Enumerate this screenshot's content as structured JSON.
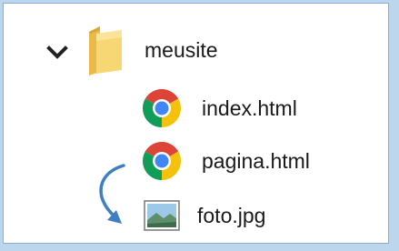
{
  "tree": {
    "folder": {
      "label": "meusite",
      "icon": "folder-icon",
      "expand_icon": "chevron-down-icon",
      "expanded": true
    },
    "files": [
      {
        "label": "index.html",
        "icon": "chrome-icon"
      },
      {
        "label": "pagina.html",
        "icon": "chrome-icon"
      },
      {
        "label": "foto.jpg",
        "icon": "image-icon"
      }
    ],
    "annotation_icon": "curved-arrow-icon"
  },
  "colors": {
    "window_frame": "#bcd6ee",
    "panel_border": "#8aaed4",
    "folder": "#f3cf63",
    "arrow": "#3f7fc0",
    "chrome_red": "#db4437",
    "chrome_yellow": "#f4c20d",
    "chrome_green": "#0f9d58",
    "chrome_blue": "#4285f4"
  }
}
